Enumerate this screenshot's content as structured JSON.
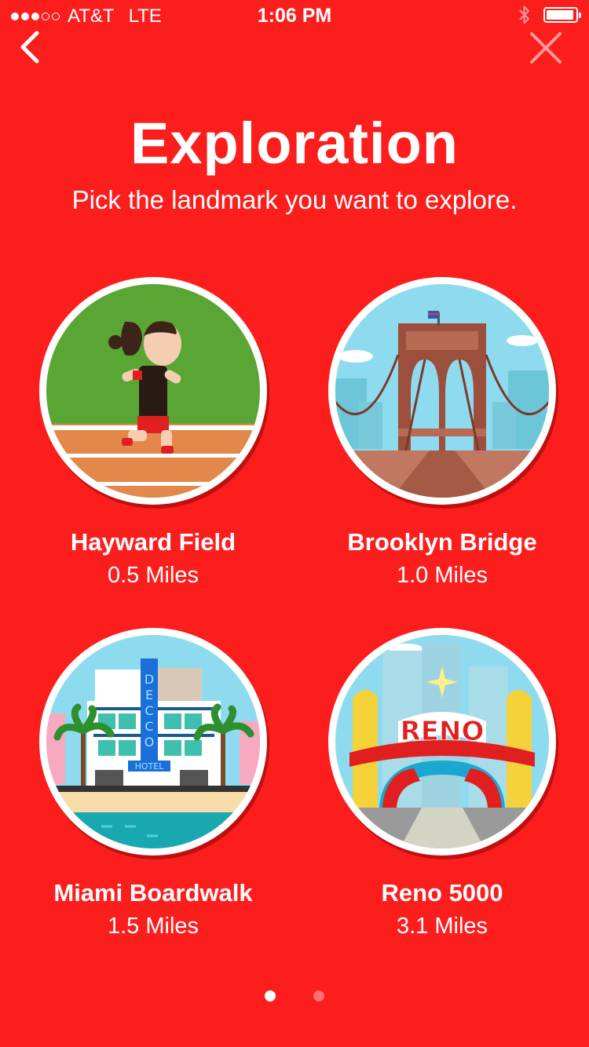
{
  "status_bar": {
    "carrier": "AT&T",
    "network": "LTE",
    "time": "1:06 PM",
    "signal_bars_filled": 3,
    "signal_bars_total": 5,
    "battery_level": 0.95,
    "bluetooth_icon": "bluetooth-icon"
  },
  "nav": {
    "back_icon": "chevron-left-icon",
    "close_icon": "close-icon"
  },
  "header": {
    "title": "Exploration",
    "subtitle": "Pick the landmark you want to explore."
  },
  "landmarks": [
    {
      "name": "Hayward Field",
      "distance": "0.5 Miles",
      "image": "runner-track-illustration"
    },
    {
      "name": "Brooklyn Bridge",
      "distance": "1.0 Miles",
      "image": "brooklyn-bridge-illustration"
    },
    {
      "name": "Miami Boardwalk",
      "distance": "1.5 Miles",
      "image": "miami-hotel-beach-illustration",
      "sign_text": "DECCO",
      "sign_subtext": "HOTEL"
    },
    {
      "name": "Reno 5000",
      "distance": "3.1 Miles",
      "image": "reno-arch-illustration",
      "sign_text": "RENO"
    }
  ],
  "pager": {
    "total": 2,
    "active": 1
  },
  "colors": {
    "background": "#fc1d1d",
    "text": "#ffffff"
  }
}
